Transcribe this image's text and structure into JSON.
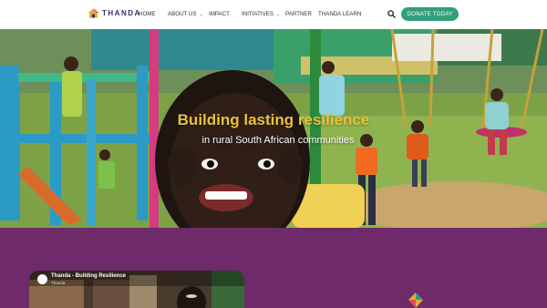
{
  "header": {
    "logo_text": "THANDA",
    "nav": [
      {
        "label": "HOME"
      },
      {
        "label": "ABOUT US",
        "dropdown": true
      },
      {
        "label": "IMPACT"
      },
      {
        "label": "INITIATIVES",
        "dropdown": true
      },
      {
        "label": "PARTNER"
      },
      {
        "label": "THANDA LEARN"
      }
    ],
    "donate_label": "DONATE TODAY",
    "search_icon": "search-icon"
  },
  "hero": {
    "title": "Building lasting resilience",
    "subtitle": "in rural South African communities"
  },
  "video": {
    "title": "Thanda - Building Resilience",
    "channel": "Thanda"
  },
  "colors": {
    "brand_green": "#2fa07a",
    "hero_title": "#e9c23a",
    "section_purple": "#6f2a69",
    "logo_navy": "#3a2f6b"
  }
}
